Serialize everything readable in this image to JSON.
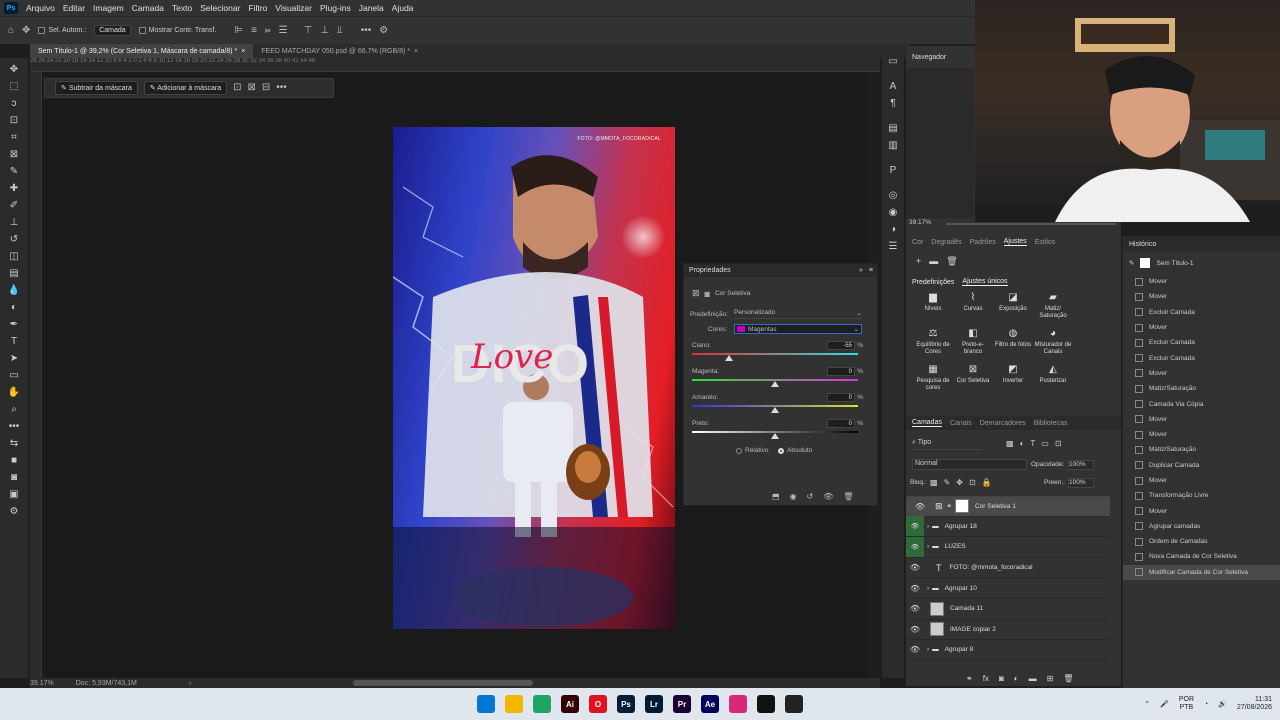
{
  "app": {
    "logo": "Ps",
    "menu": [
      "Arquivo",
      "Editar",
      "Imagem",
      "Camada",
      "Texto",
      "Selecionar",
      "Filtro",
      "Visualizar",
      "Plug-ins",
      "Janela",
      "Ajuda"
    ]
  },
  "options_bar": {
    "auto_select_label": "Sel. Autom.:",
    "auto_select_value": "Camada",
    "show_transform_label": "Mostrar Contr. Transf."
  },
  "tabs": [
    {
      "label": "Sem Título-1 @ 39,2% (Cor Seletiva 1, Máscara de camada/8) *",
      "close": "×"
    },
    {
      "label": "FEED MATCHDAY 050.psd @ 66,7% (RGB/8) *",
      "close": "×"
    }
  ],
  "mask_bar": {
    "subtract": "Subtrair da máscara",
    "add": "Adicionar à máscara"
  },
  "ruler_ticks": "28   26   24   22   20   18   16   14   12   10   8   6   4   2   0   2   4   6   8   10   12   14   16   18   20   22   24   26   28   30   32   34   36   38   40   42   44   46",
  "artwork": {
    "credit": "FOTO: @MMOTA_FOCORADICAL",
    "name": "DICO",
    "script": "Love"
  },
  "properties": {
    "title": "Propriedades",
    "layer_type": "Cor Seletiva",
    "preset_label": "Predefinição:",
    "preset_value": "Personalizado",
    "colors_label": "Cores:",
    "colors_value": "Magentas",
    "colors_swatch": "#c400c4",
    "sliders": [
      {
        "label": "Ciano:",
        "value": "-55",
        "unit": "%",
        "level": -55
      },
      {
        "label": "Magenta:",
        "value": "0",
        "unit": "%",
        "level": 0
      },
      {
        "label": "Amarelo:",
        "value": "0",
        "unit": "%",
        "level": 0
      },
      {
        "label": "Preto:",
        "value": "0",
        "unit": "%",
        "level": 0
      }
    ],
    "relative": "Relativo",
    "absolute": "Absoluto"
  },
  "navigator": {
    "title": "Navegador",
    "zoom": "39.17%"
  },
  "adjust_panel": {
    "tabs": [
      "Cor",
      "Degradês",
      "Padrões",
      "Ajustes",
      "Estilos"
    ],
    "active_tab": "Ajustes",
    "subtabs": [
      "Predefinições",
      "Ajustes únicos"
    ],
    "items": [
      {
        "label": "Níveis",
        "icon": "levels-icon"
      },
      {
        "label": "Curvas",
        "icon": "curves-icon"
      },
      {
        "label": "Exposição",
        "icon": "exposure-icon"
      },
      {
        "label": "Matiz/ Saturação",
        "icon": "hue-saturation-icon"
      },
      {
        "label": "Equilíbrio de Cores",
        "icon": "color-balance-icon"
      },
      {
        "label": "Preto-e-branco",
        "icon": "black-white-icon"
      },
      {
        "label": "Filtro de fotos",
        "icon": "photo-filter-icon"
      },
      {
        "label": "Misturador de Canais",
        "icon": "channel-mixer-icon"
      },
      {
        "label": "Pesquisa de cores",
        "icon": "color-lookup-icon"
      },
      {
        "label": "Cor Seletiva",
        "icon": "selective-color-icon"
      },
      {
        "label": "Inverter",
        "icon": "invert-icon"
      },
      {
        "label": "Posterizar",
        "icon": "posterize-icon"
      }
    ]
  },
  "layers_panel": {
    "tabs": [
      "Camadas",
      "Canais",
      "Demarcadores",
      "Bibliotecas"
    ],
    "filter": "Tipo",
    "blend": "Normal",
    "opacity_label": "Opacidade:",
    "opacity": "100%",
    "lock_label": "Bloq.:",
    "fill_label": "Preen.:",
    "fill": "100%",
    "layers": [
      {
        "name": "Cor Seletiva 1",
        "kind": "adjustment",
        "selected": true
      },
      {
        "name": "Agrupar 18",
        "kind": "group",
        "selected": false
      },
      {
        "name": "LUZES",
        "kind": "group",
        "selected": false
      },
      {
        "name": "FOTO: @mmota_focoradical",
        "kind": "text",
        "selected": false
      },
      {
        "name": "Agrupar 10",
        "kind": "group",
        "selected": false
      },
      {
        "name": "Camada 11",
        "kind": "pixel",
        "selected": false
      },
      {
        "name": "IMAGE copiar 2",
        "kind": "pixel",
        "selected": false
      },
      {
        "name": "Agrupar 8",
        "kind": "group",
        "selected": false
      }
    ]
  },
  "history": {
    "title": "Histórico",
    "snapshot": "Sem Título-1",
    "items": [
      "Mover",
      "Mover",
      "Excluir Camada",
      "Mover",
      "Excluir Camada",
      "Excluir Camada",
      "Mover",
      "Matiz/Saturação",
      "Camada Via Cópia",
      "Mover",
      "Mover",
      "Matiz/Saturação",
      "Duplicar Camada",
      "Mover",
      "Transformação Livre",
      "Mover",
      "Agrupar camadas",
      "Ordem de Camadas",
      "Nova Camada de Cor Seletiva",
      "Modificar Camada de Cor Seletiva"
    ]
  },
  "status": {
    "zoom": "39.17%",
    "doc": "Doc: 5,93M/743,1M",
    "arrow": "›"
  },
  "taskbar": {
    "apps": [
      {
        "name": "start",
        "label": "",
        "color": "#0078d4"
      },
      {
        "name": "explorer",
        "label": "",
        "color": "#f2b600"
      },
      {
        "name": "chrome",
        "label": "",
        "color": "#1ea362"
      },
      {
        "name": "illustrator",
        "label": "Ai",
        "color": "#330000"
      },
      {
        "name": "opera",
        "label": "O",
        "color": "#e0121d"
      },
      {
        "name": "photoshop",
        "label": "Ps",
        "color": "#001e36"
      },
      {
        "name": "lightroom",
        "label": "Lr",
        "color": "#001a33"
      },
      {
        "name": "premiere",
        "label": "Pr",
        "color": "#1a0033"
      },
      {
        "name": "after-effects",
        "label": "Ae",
        "color": "#00005b"
      },
      {
        "name": "instagram",
        "label": "",
        "color": "#d62976"
      },
      {
        "name": "capcut",
        "label": "",
        "color": "#111111"
      },
      {
        "name": "obs",
        "label": "",
        "color": "#222222"
      }
    ],
    "lang_top": "POR",
    "lang_bottom": "PTB",
    "time": "11:31",
    "date": "27/08/2026"
  }
}
